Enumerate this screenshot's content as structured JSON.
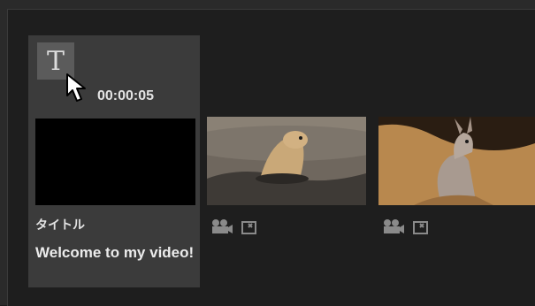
{
  "timeline": {
    "title_clip": {
      "icon_letter": "T",
      "duration": "00:00:05",
      "type_label": "タイトル",
      "text": "Welcome to my video!"
    },
    "video_clips": [
      {
        "icon": "movie-camera-icon",
        "extra_icon": "photo-frame-icon"
      },
      {
        "icon": "movie-camera-icon",
        "extra_icon": "photo-frame-icon"
      }
    ]
  }
}
